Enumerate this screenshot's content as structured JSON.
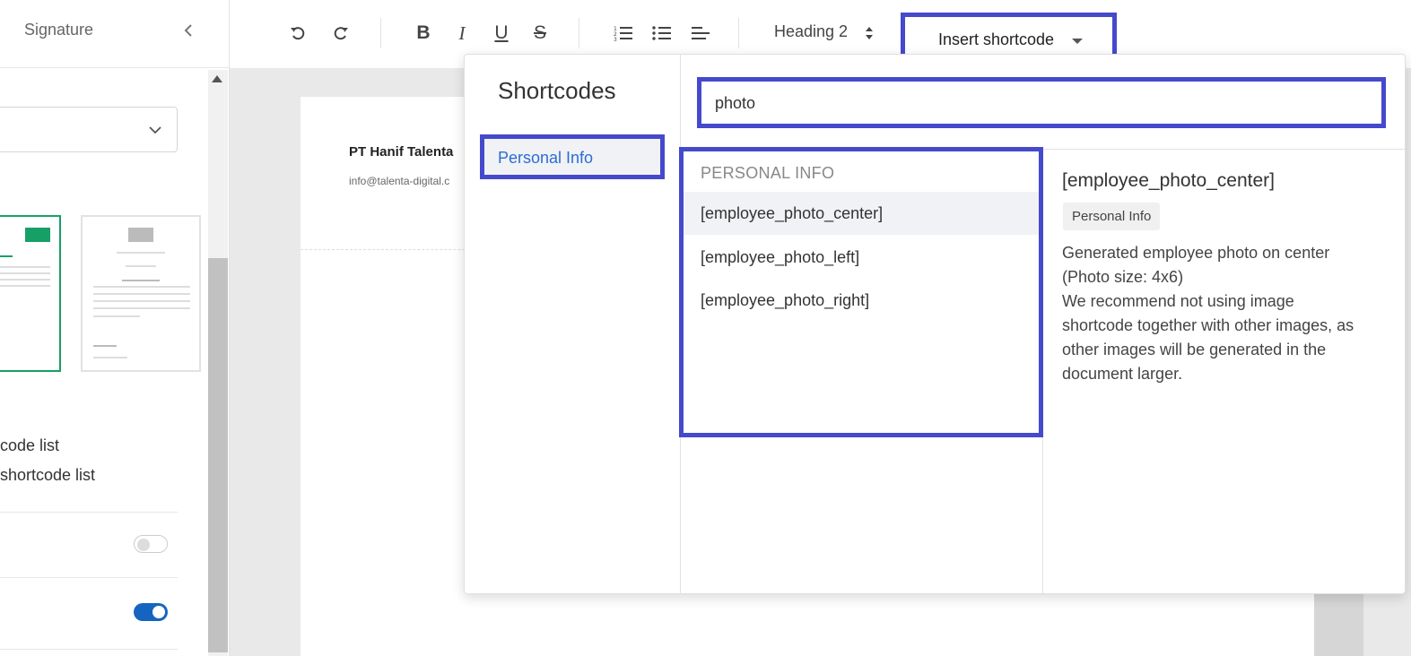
{
  "left_panel": {
    "title": "Signature",
    "text_line_1": "code list",
    "text_line_2": "shortcode list"
  },
  "toolbar": {
    "heading_select": "Heading 2",
    "insert_shortcode_label": "Insert shortcode"
  },
  "document": {
    "company": "PT Hanif Talenta",
    "email": "info@talenta-digital.c"
  },
  "shortcodes": {
    "title": "Shortcodes",
    "categories": [
      "Personal Info"
    ],
    "search_value": "photo",
    "list_heading": "PERSONAL INFO",
    "items": [
      "[employee_photo_center]",
      "[employee_photo_left]",
      "[employee_photo_right]"
    ],
    "detail": {
      "title": "[employee_photo_center]",
      "tag": "Personal Info",
      "description_lines": [
        "Generated employee photo on center",
        "(Photo size: 4x6)",
        "We recommend not using image",
        "shortcode together with other images, as",
        "other images will be generated in the",
        "document larger."
      ]
    }
  },
  "colors": {
    "highlight_border": "#4549cc",
    "accent_blue": "#2b6cd8",
    "template_selected": "#16a065",
    "toggle_on": "#1565c0"
  }
}
